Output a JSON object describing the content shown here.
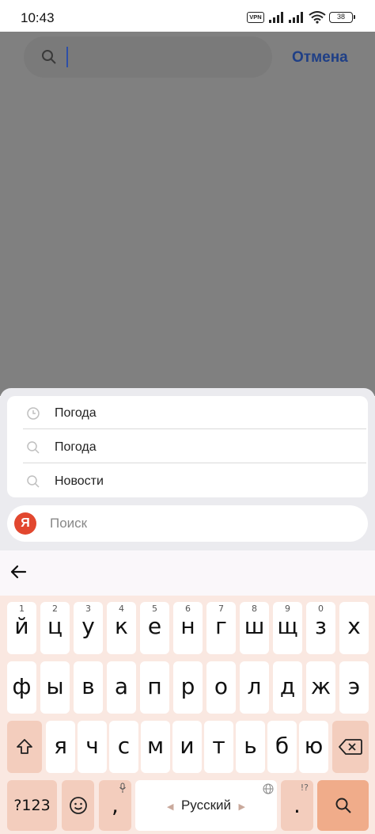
{
  "status": {
    "time": "10:43",
    "vpn": "VPN",
    "battery": "38"
  },
  "search": {
    "placeholder": "",
    "cancel": "Отмена"
  },
  "suggestions": [
    {
      "icon": "history-icon",
      "text": "Погода"
    },
    {
      "icon": "search-icon",
      "text": "Погода"
    },
    {
      "icon": "search-icon",
      "text": "Новости"
    }
  ],
  "yandex": {
    "logo": "Я",
    "label": "Поиск",
    "logo_color": "#e2472f"
  },
  "keyboard": {
    "row1": [
      [
        "й",
        "1"
      ],
      [
        "ц",
        "2"
      ],
      [
        "у",
        "3"
      ],
      [
        "к",
        "4"
      ],
      [
        "е",
        "5"
      ],
      [
        "н",
        "6"
      ],
      [
        "г",
        "7"
      ],
      [
        "ш",
        "8"
      ],
      [
        "щ",
        "9"
      ],
      [
        "з",
        "0"
      ],
      [
        "х",
        ""
      ]
    ],
    "row2": [
      "ф",
      "ы",
      "в",
      "а",
      "п",
      "р",
      "о",
      "л",
      "д",
      "ж",
      "э"
    ],
    "row3": [
      "я",
      "ч",
      "с",
      "м",
      "и",
      "т",
      "ь",
      "б",
      "ю"
    ],
    "sym": "?123",
    "comma": ",",
    "space": "Русский",
    "period": ".",
    "period_hint": "!?",
    "colors": {
      "bg": "#fae8e1",
      "key": "#ffffff",
      "special": "#f3cdbd",
      "enter": "#f0ac8a"
    }
  }
}
